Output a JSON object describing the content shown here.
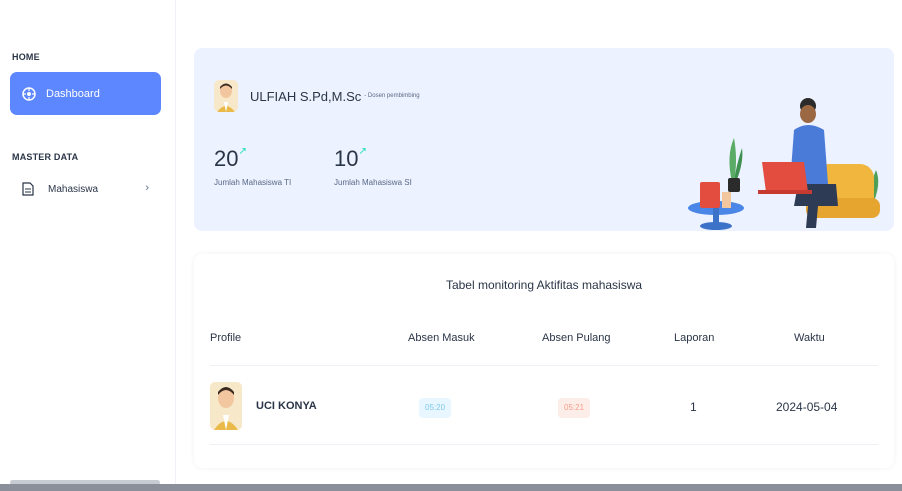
{
  "sidebar": {
    "home_label": "HOME",
    "dashboard_label": "Dashboard",
    "master_label": "MASTER DATA",
    "mahasiswa_label": "Mahasiswa",
    "chevron": "›"
  },
  "welcome": {
    "user_name": "ULFIAH S.Pd,M.Sc",
    "user_role": "- Dosen pembimbing",
    "stat1_value": "20",
    "stat1_label": "Jumlah Mahasiswa TI",
    "stat2_value": "10",
    "stat2_label": "Jumlah Mahasiswa SI",
    "trend_glyph": "↗"
  },
  "table": {
    "title": "Tabel monitoring Aktifitas mahasiswa",
    "headers": [
      "Profile",
      "Absen Masuk",
      "Absen Pulang",
      "Laporan",
      "Waktu"
    ],
    "rows": [
      {
        "name": "UCI KONYA",
        "absen_masuk": "05:20",
        "absen_pulang": "05:21",
        "laporan": "1",
        "waktu": "2024-05-04"
      }
    ]
  },
  "colors": {
    "primary": "#5d87ff",
    "welcome_bg": "#ecf2ff",
    "trend": "#13deb9",
    "badge_in_bg": "#e8f7ff",
    "badge_out_bg": "#fdede8"
  },
  "icons": {
    "dashboard": "dashboard-icon",
    "mahasiswa": "file-icon",
    "chevron": "chevron-right-icon",
    "trend": "trend-up-icon"
  }
}
